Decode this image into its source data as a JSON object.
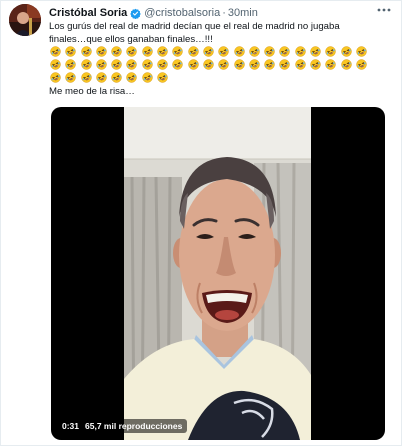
{
  "tweet": {
    "author_name": "Cristóbal Soria",
    "handle": "@cristobalsoria",
    "separator": "·",
    "time": "30min",
    "line1": "Los gurús del real de madrid decían que el real de madrid no jugaba",
    "line2": "finales…que ellos ganaban finales…!!!",
    "laugh_emoji_count": 50,
    "laugh_text": "Me meo de la risa…"
  },
  "icons": {
    "verified": "verified-badge-icon",
    "more": "more-options-icon",
    "emoji": "rolling-on-floor-laughing-emoji"
  },
  "video": {
    "current_time": "0:31",
    "views": "65,7 mil reproducciones"
  },
  "colors": {
    "verified_blue": "#1d9bf0",
    "secondary_text": "#536471",
    "emoji_yellow": "#f9c622"
  }
}
